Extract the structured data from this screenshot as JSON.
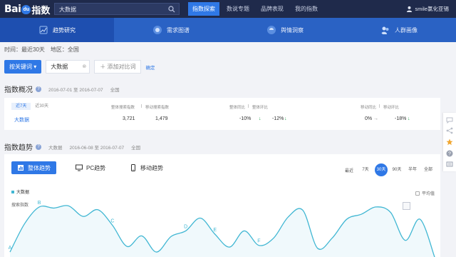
{
  "header": {
    "logo": {
      "bai": "Bai",
      "paw": "du",
      "index": "指数"
    },
    "search": {
      "value": "大数据"
    },
    "nav": [
      "指数探索",
      "数说专题",
      "品牌表现",
      "我的指数"
    ],
    "user": "smile氯化亚锡"
  },
  "modules": [
    "趋势研究",
    "需求图谱",
    "舆情洞察",
    "人群画像"
  ],
  "filters": {
    "time": "时间：最近30天",
    "region": "地区：全国"
  },
  "keyword_row": {
    "by_keyword": "按关键词 ▾",
    "keyword": "大数据",
    "add": "＋ 添加对比词",
    "confirm": "确定"
  },
  "overview": {
    "title": "指数概况",
    "date_range": "2016-07-01 至 2016-07-07",
    "region": "全国",
    "tabs": [
      "近7天",
      "近30天"
    ],
    "headers": {
      "overall": "整体搜索指数",
      "sep1": "|",
      "mobile": "移动搜索指数",
      "yoy_overall": "整体同比",
      "sep2": "|",
      "mom_overall": "整体环比",
      "yoy_mobile": "移动同比",
      "sep3": "|",
      "mom_mobile": "移动环比"
    },
    "row": {
      "keyword": "大数据",
      "overall": "3,721",
      "mobile": "1,479",
      "yoy_overall": "-10%",
      "mom_overall": "-12%",
      "yoy_mobile": "0%",
      "mom_mobile": "-18%"
    }
  },
  "trend": {
    "title": "指数趋势",
    "keyword": "大数据",
    "date_range": "2016-06-08 至 2016-07-07",
    "region": "全国",
    "tabs": [
      "整体趋势",
      "PC趋势",
      "移动趋势"
    ],
    "ranges": [
      "最近",
      "7天",
      "30天",
      "90天",
      "半年",
      "全部"
    ],
    "active_range": "30天",
    "avg_label": "平均值",
    "ylabel": "搜索指数",
    "legend": "大数据",
    "accent": "#41b7d3"
  },
  "chart_data": {
    "type": "line",
    "series": [
      {
        "name": "大数据",
        "values": [
          0.86,
          0.35,
          0.05,
          0.07,
          0.03,
          0.22,
          0.1,
          0.38,
          0.76,
          0.57,
          0.86,
          0.58,
          0.48,
          0.25,
          0.54,
          0.77,
          0.48,
          0.74,
          0.61,
          0.23,
          0.11,
          0.79,
          0.61,
          0.27,
          0.18,
          0.05,
          0.15,
          0.65,
          0.27,
          0.95
        ]
      }
    ],
    "point_labels": [
      {
        "index": 0,
        "label": "A"
      },
      {
        "index": 2,
        "label": "B"
      },
      {
        "index": 7,
        "label": "C"
      },
      {
        "index": 12,
        "label": "D"
      },
      {
        "index": 14,
        "label": "E"
      },
      {
        "index": 17,
        "label": "F"
      }
    ],
    "legend": "大数据",
    "ylabel": "搜索指数"
  },
  "rail": [
    "chat-icon",
    "share-icon",
    "star-icon",
    "help-icon",
    "comment-icon"
  ]
}
